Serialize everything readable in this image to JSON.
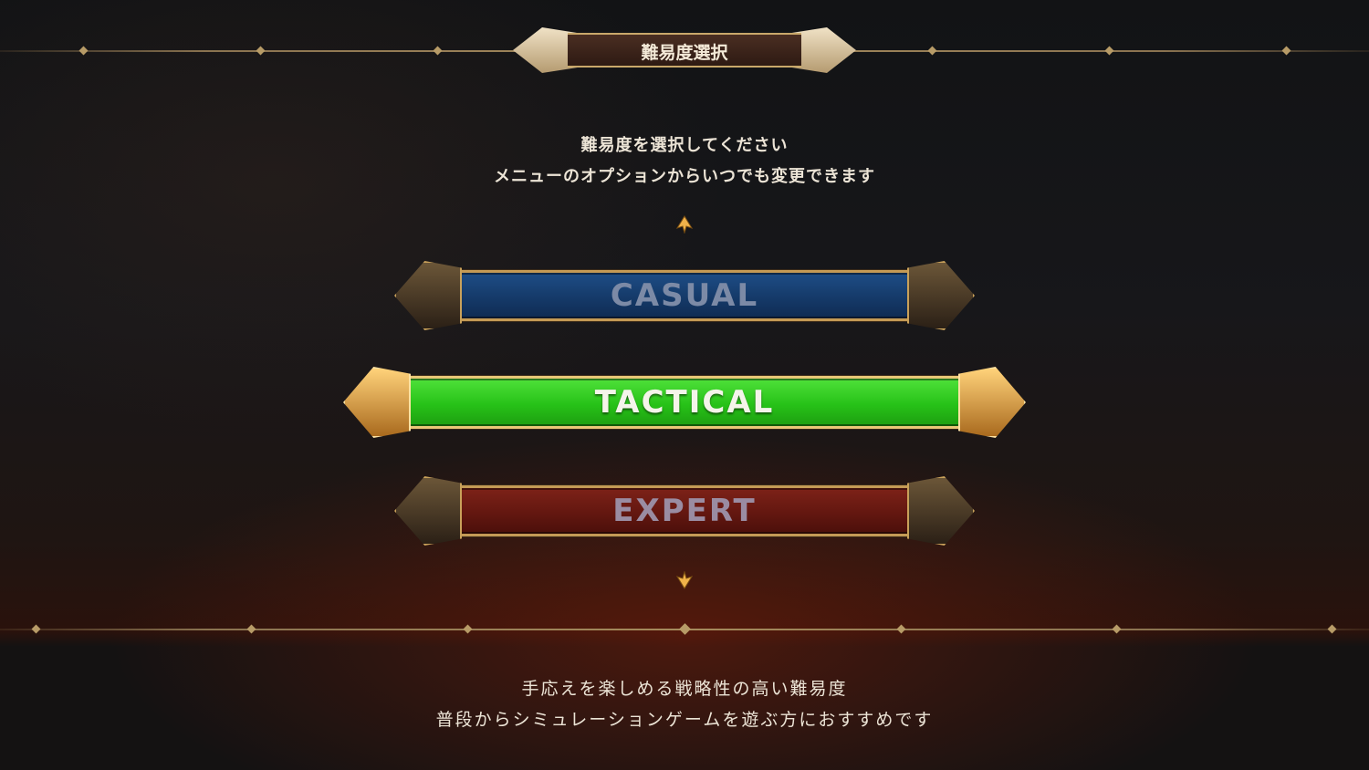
{
  "header": {
    "title": "難易度選択"
  },
  "instructions": {
    "line1": "難易度を選択してください",
    "line2": "メニューのオプションからいつでも変更できます"
  },
  "difficulties": [
    {
      "label": "CASUAL",
      "state": "unselected"
    },
    {
      "label": "TACTICAL",
      "state": "selected"
    },
    {
      "label": "EXPERT",
      "state": "unselected"
    }
  ],
  "description": {
    "line1": "手応えを楽しめる戦略性の高い難易度",
    "line2": "普段からシミュレーションゲームを遊ぶ方におすすめです"
  },
  "icons": {
    "scroll_up": "up-arrow-icon",
    "scroll_down": "down-arrow-icon"
  },
  "colors": {
    "casual": "#1e4d86",
    "tactical": "#2fcf1f",
    "expert": "#6e1a12",
    "gold": "#c49a55"
  }
}
